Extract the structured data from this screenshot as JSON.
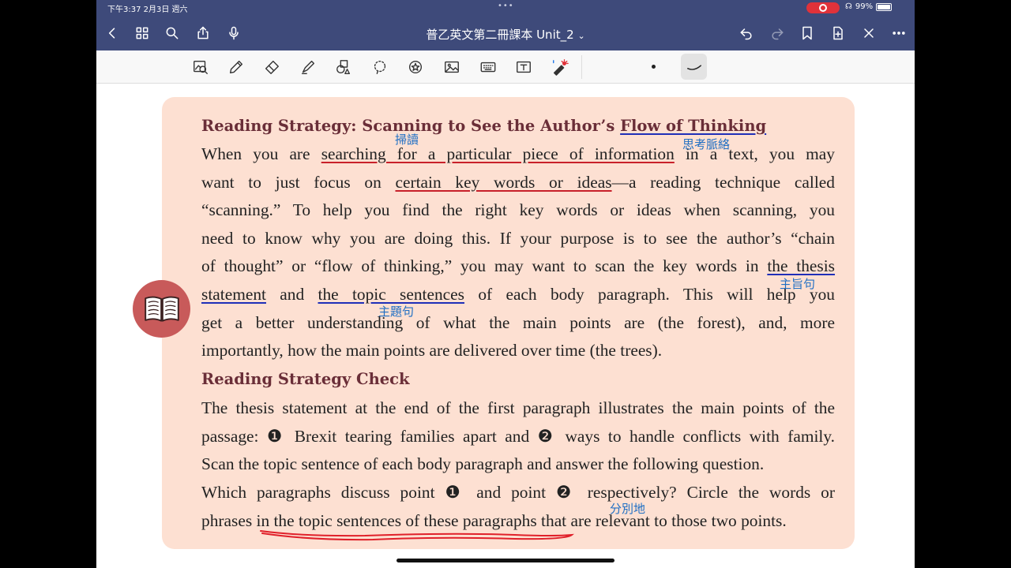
{
  "status_bar": {
    "time_date": "下午3:37   2月3日 週六",
    "battery": "99%"
  },
  "nav": {
    "title": "普乙英文第二冊課本 Unit_2",
    "title_chevron": "⌄"
  },
  "content": {
    "heading1_a": "Reading Strategy: Scanning to See the Author’s ",
    "heading1_b": "Flow of Thinking",
    "p1": {
      "l1_a": "When you are ",
      "l1_b": "searching for a particular piece of information",
      "l1_c": " in a text, you may",
      "l2_a": "want to just focus on ",
      "l2_b": "certain key words or ideas",
      "l2_c": "—a reading technique called",
      "l3": "“scanning.” To help you find the right key words or ideas when scanning, you",
      "l4": "need to know why you are doing this. If your purpose is to see the author’s “chain",
      "l5_a": "of thought” or “flow of thinking,” you may want to scan the key words in ",
      "l5_b": "the thesis",
      "l6_a": "statement",
      "l6_b": " and ",
      "l6_c": "the topic sentences",
      "l6_d": " of each body paragraph. This will help you",
      "l7": "get a better understanding of what the main points are (the forest), and, more",
      "l8": "importantly, how the main points are delivered over time (the trees)."
    },
    "heading2": "Reading Strategy Check",
    "p2": {
      "l1": "The thesis statement at the end of the first paragraph illustrates the main points of the",
      "l2": "passage: ❶ Brexit tearing families apart and ❷ ways to handle conflicts with family.",
      "l3": "Scan the topic sentence of each body paragraph and answer the following question.",
      "l4": "Which paragraphs discuss point ❶ and point ❷ respectively? Circle the words or",
      "l5_a": "phrases ",
      "l5_b": "in the topic sentences of these paragraphs",
      "l5_c": " that are relevant to those two points."
    }
  },
  "annotations": {
    "scan_reading": "掃讀",
    "flow_of_thinking": "思考脈絡",
    "thesis_statement": "主旨句",
    "topic_sentence": "主題句",
    "respectively": "分別地"
  },
  "colors": {
    "nav_bg": "#3e4a7a",
    "card_bg": "#fde0d2",
    "heading": "#6a2e38",
    "ink_red": "#c8202a",
    "ink_blue": "#1f2fb8",
    "note_blue": "#1f6fc4",
    "badge": "#c85a5a"
  }
}
